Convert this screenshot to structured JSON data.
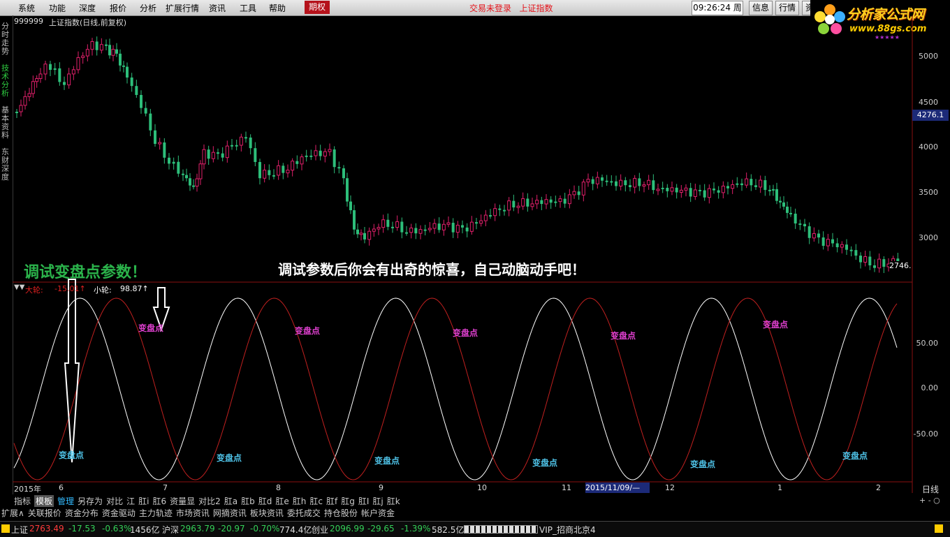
{
  "menu": {
    "items": [
      "系统",
      "功能",
      "深度",
      "报价",
      "分析",
      "扩展行情",
      "资讯",
      "工具",
      "帮助"
    ],
    "options_tab": "期权",
    "status": "交易未登录",
    "status_index": "上证指数",
    "time": "09:26:24",
    "weekday": "周日",
    "info_btn": "信息",
    "quote_btn": "行情",
    "extra_btn": "资"
  },
  "logo": {
    "title": "分析家公式网",
    "url": "www.88gs.com",
    "stars": "★★★★★"
  },
  "sidebar": {
    "tabs": [
      "分时走势",
      "技术分析",
      "基本资料",
      "东财深度"
    ],
    "active": 1
  },
  "stock": {
    "code": "999999",
    "name": "上证指数(日线,前复权)"
  },
  "price_axis": {
    "ticks": [
      "5000",
      "4500",
      "4000",
      "3500",
      "3000"
    ],
    "current": "4276.1",
    "last": "2746."
  },
  "indicator": {
    "icon": "▼▼",
    "big_label": "大轮:",
    "big_value": "-15.01↑",
    "small_label": "小轮:",
    "small_value": "98.87↑",
    "ticks": [
      "50.00",
      "0.00",
      "-50.00"
    ],
    "turn_label": "变盘点"
  },
  "annotations": {
    "left": "调试变盘点参数！",
    "center": "调试参数后你会有出奇的惊喜，自己动脑动手吧！"
  },
  "x_axis": {
    "labels": [
      "2015年",
      "6",
      "7",
      "8",
      "9",
      "10",
      "11",
      "12",
      "1",
      "2"
    ],
    "highlight_date": "2015/11/09/—",
    "period": "日线"
  },
  "tabs_row1": [
    "指标",
    "模板",
    "管理",
    "另存为",
    "对比",
    "江",
    "肛i",
    "肛6",
    "资量显",
    "对比2",
    "肛a",
    "肛b",
    "肛d",
    "肛e",
    "肛h",
    "肛c",
    "肛f",
    "肛g",
    "肛I",
    "肛j",
    "肛k"
  ],
  "tabs_row2": [
    "扩展∧",
    "关联报价",
    "资金分布",
    "资金驱动",
    "主力轨迹",
    "市场资讯",
    "网摘资讯",
    "板块资讯",
    "委托成交",
    "持仓股份",
    "帐户资金"
  ],
  "zoom": "+ - ○",
  "status_bar": {
    "sh_label": "上证",
    "sh_price": "2763.49",
    "sh_change": "-17.53",
    "sh_pct": "-0.63%",
    "sh_vol": "1456亿",
    "hs_label": "沪深",
    "hs_price": "2963.79",
    "hs_change": "-20.97",
    "hs_pct": "-0.70%",
    "hs_vol": "774.4亿",
    "cy_label": "创业",
    "cy_price": "2096.99",
    "cy_change": "-29.65",
    "cy_pct": "-1.39%",
    "cy_vol": "582.5亿",
    "server": "VIP_招商北京4"
  },
  "colors": {
    "up": "#ff3b3b",
    "down": "#34d058",
    "red_wave": "#c0201f",
    "white_wave": "#ffffff",
    "turn_top": "#e040d0",
    "turn_bottom": "#4fc3e8"
  }
}
